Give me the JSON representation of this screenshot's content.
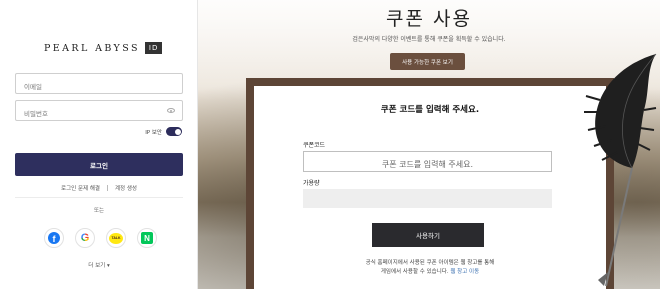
{
  "login": {
    "logo_text": "PEARL ABYSS",
    "logo_badge": "ID",
    "email_placeholder": "이메일",
    "password_placeholder": "비밀번호",
    "ip_label": "IP 보안",
    "ip_security_on": true,
    "login_button": "로그인",
    "login_problem": "로그인 문제 해결",
    "create_account": "계정 생성",
    "or_label": "또는",
    "social": [
      "facebook-icon",
      "google-icon",
      "kakaotalk-icon",
      "naver-icon"
    ],
    "kakao_text": "TALK",
    "naver_text": "N",
    "facebook_text": "f",
    "google_text": "G",
    "more_label": "더 보기",
    "more_arrow": "▾"
  },
  "coupon": {
    "title": "쿠폰 사용",
    "subtitle": "검은사막의 다양한 이벤트를 통해 쿠폰을 획득할 수 있습니다.",
    "available_coupons_button": "사용 가능한 쿠폰 보기",
    "heading": "쿠폰 코드를 입력해 주세요.",
    "code_label": "쿠폰코드",
    "code_placeholder": "쿠폰 코드를 입력해 주세요.",
    "availability_label": "가용량",
    "use_button": "사용하기",
    "note_line1": "공식 홈페이지에서 사용된 쿠폰 아이템은 웹 창고를 통해",
    "note_line2": "게임에서 사용할 수 있습니다.",
    "note_link": "웹 창고 이동"
  },
  "colors": {
    "login_button": "#2e2f5e",
    "coupon_list_button": "#6b4f3e",
    "use_button": "#2a2a2e",
    "frame": "#5d4536",
    "link": "#3a6fb0"
  }
}
